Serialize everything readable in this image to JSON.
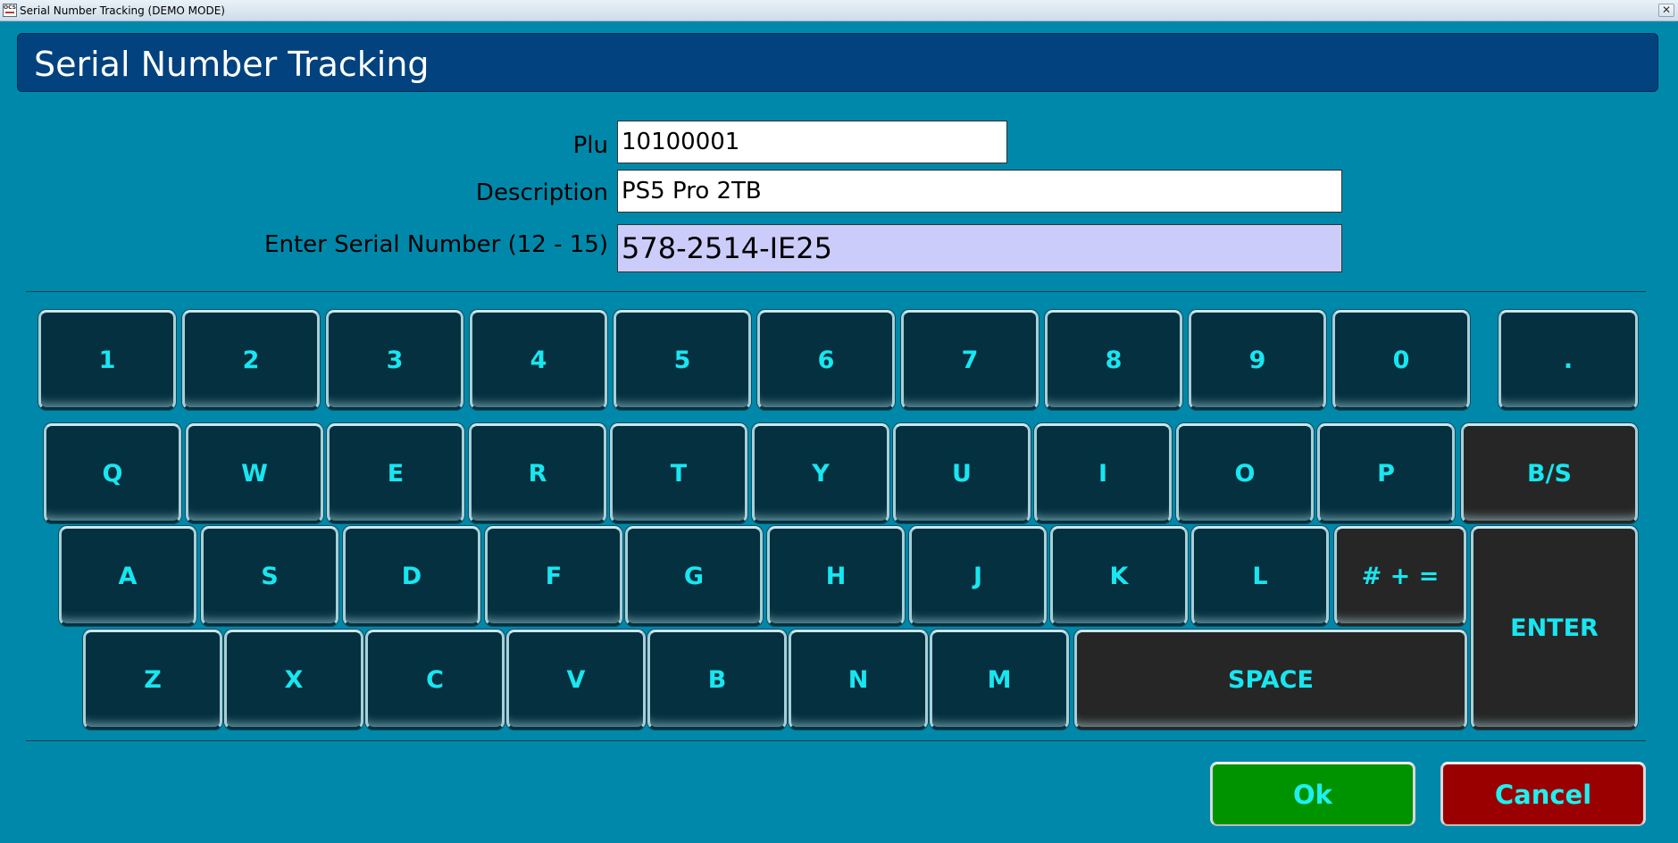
{
  "window": {
    "title": "Serial Number Tracking (DEMO MODE)",
    "icon_label": "OCS"
  },
  "header": {
    "title": "Serial Number Tracking"
  },
  "form": {
    "plu_label": "Plu",
    "plu_value": "10100001",
    "description_label": "Description",
    "description_value": "PS5 Pro 2TB",
    "serial_label": "Enter Serial Number (12 - 15)",
    "serial_value": "578-2514-IE25"
  },
  "keyboard": {
    "row1": [
      "1",
      "2",
      "3",
      "4",
      "5",
      "6",
      "7",
      "8",
      "9",
      "0",
      "."
    ],
    "row2": [
      "Q",
      "W",
      "E",
      "R",
      "T",
      "Y",
      "U",
      "I",
      "O",
      "P",
      "B/S"
    ],
    "row3": [
      "A",
      "S",
      "D",
      "F",
      "G",
      "H",
      "J",
      "K",
      "L",
      "# + ="
    ],
    "row4": [
      "Z",
      "X",
      "C",
      "V",
      "B",
      "N",
      "M",
      "SPACE"
    ],
    "enter": "ENTER"
  },
  "actions": {
    "ok": "Ok",
    "cancel": "Cancel"
  },
  "colors": {
    "background": "#0088aa",
    "header": "#02427f",
    "key": "#05303f",
    "key_special": "#262626",
    "key_text": "#18e6f0",
    "serial_field": "#ccccfa",
    "ok": "#009300",
    "cancel": "#9a0000"
  }
}
